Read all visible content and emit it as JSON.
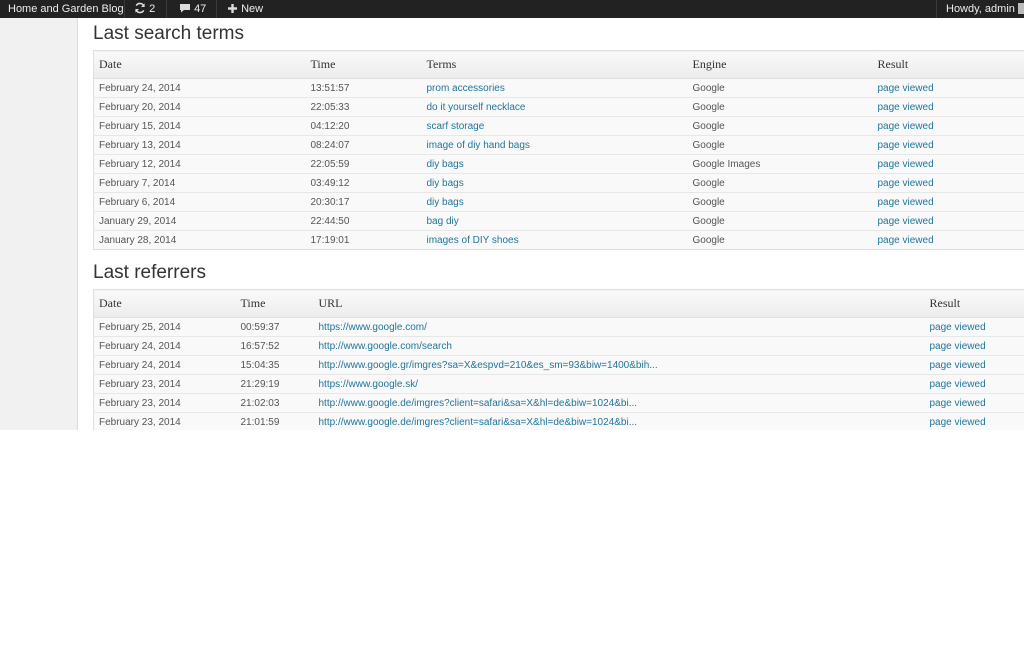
{
  "adminbar": {
    "site_name": "Home and Garden Blog",
    "updates_count": "2",
    "comments_count": "47",
    "new_label": "New",
    "greeting": "Howdy, admin",
    "colors": {
      "bg": "#222222"
    }
  },
  "search_terms": {
    "title": "Last search terms",
    "headers": {
      "date": "Date",
      "time": "Time",
      "terms": "Terms",
      "engine": "Engine",
      "result": "Result"
    },
    "rows": [
      {
        "date": "February 24, 2014",
        "time": "13:51:57",
        "terms": "prom accessories",
        "engine": "Google",
        "result": "page viewed"
      },
      {
        "date": "February 20, 2014",
        "time": "22:05:33",
        "terms": "do it yourself necklace",
        "engine": "Google",
        "result": "page viewed"
      },
      {
        "date": "February 15, 2014",
        "time": "04:12:20",
        "terms": "scarf storage",
        "engine": "Google",
        "result": "page viewed"
      },
      {
        "date": "February 13, 2014",
        "time": "08:24:07",
        "terms": "image of diy hand bags",
        "engine": "Google",
        "result": "page viewed"
      },
      {
        "date": "February 12, 2014",
        "time": "22:05:59",
        "terms": "diy bags",
        "engine": "Google Images",
        "result": "page viewed"
      },
      {
        "date": "February 7, 2014",
        "time": "03:49:12",
        "terms": "diy bags",
        "engine": "Google",
        "result": "page viewed"
      },
      {
        "date": "February 6, 2014",
        "time": "20:30:17",
        "terms": "diy bags",
        "engine": "Google",
        "result": "page viewed"
      },
      {
        "date": "January 29, 2014",
        "time": "22:44:50",
        "terms": "bag diy",
        "engine": "Google",
        "result": "page viewed"
      },
      {
        "date": "January 28, 2014",
        "time": "17:19:01",
        "terms": "images of DIY shoes",
        "engine": "Google",
        "result": "page viewed"
      }
    ]
  },
  "referrers": {
    "title": "Last referrers",
    "headers": {
      "date": "Date",
      "time": "Time",
      "url": "URL",
      "result": "Result"
    },
    "rows": [
      {
        "date": "February 25, 2014",
        "time": "00:59:37",
        "url": "https://www.google.com/",
        "result": "page viewed"
      },
      {
        "date": "February 24, 2014",
        "time": "16:57:52",
        "url": "http://www.google.com/search",
        "result": "page viewed"
      },
      {
        "date": "February 24, 2014",
        "time": "15:04:35",
        "url": "http://www.google.gr/imgres?sa=X&espvd=210&es_sm=93&biw=1400&bih...",
        "result": "page viewed"
      },
      {
        "date": "February 23, 2014",
        "time": "21:29:19",
        "url": "https://www.google.sk/",
        "result": "page viewed"
      },
      {
        "date": "February 23, 2014",
        "time": "21:02:03",
        "url": "http://www.google.de/imgres?client=safari&sa=X&hl=de&biw=1024&bi...",
        "result": "page viewed"
      },
      {
        "date": "February 23, 2014",
        "time": "21:01:59",
        "url": "http://www.google.de/imgres?client=safari&sa=X&hl=de&biw=1024&bi...",
        "result": "page viewed"
      }
    ]
  },
  "colors": {
    "link": "#21759b",
    "text": "#555555",
    "heading": "#333333"
  }
}
